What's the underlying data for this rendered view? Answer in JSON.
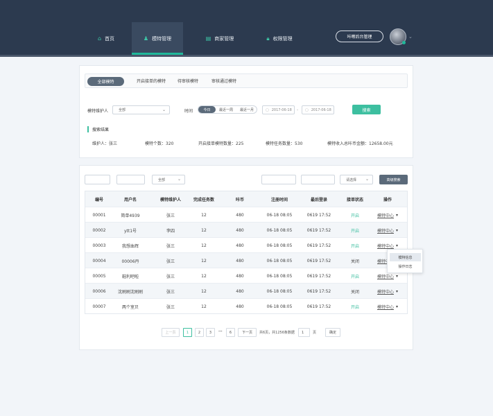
{
  "nav": {
    "items": [
      {
        "label": "首页",
        "icon": "home-icon"
      },
      {
        "label": "模特管理",
        "icon": "user-group-icon"
      },
      {
        "label": "商家管理",
        "icon": "shop-icon"
      },
      {
        "label": "权限管理",
        "icon": "lock-icon"
      }
    ],
    "admin_button": "咔嚓后台管理",
    "accent": "#1fb89a"
  },
  "tabs": [
    "全部模特",
    "开启接单的模特",
    "待审核模特",
    "审核通过模特"
  ],
  "filter": {
    "guardian_label": "模特维护人",
    "guardian_value": "全部",
    "time_label": "时间",
    "time_segments": [
      "今日",
      "最近一周",
      "最近一月"
    ],
    "date_from": "2017-06-18",
    "date_to": "2017-06-18",
    "date_sep": "-",
    "search_button": "搜索"
  },
  "results": {
    "title": "搜索结果",
    "stats": [
      "维护人：张三",
      "模特个数：320",
      "开启接单模特数量：225",
      "模特任务数量：530",
      "模特收入总咔币金额：12658.00元"
    ]
  },
  "toolbar": {
    "select1": "全部",
    "select2": "请选择",
    "advanced_search": "高级搜索"
  },
  "table": {
    "headers": [
      "编号",
      "用户名",
      "模特维护人",
      "完成任务数",
      "咔币",
      "注册时间",
      "最后登录",
      "接单状态",
      "操作"
    ],
    "rows": [
      [
        "00001",
        "简单4939",
        "张三",
        "12",
        "480",
        "06-18  08:05",
        "0619 17:52",
        "开启",
        "模特中心"
      ],
      [
        "00002",
        "ytt1号",
        "李四",
        "12",
        "480",
        "06-18  08:05",
        "0619 17:52",
        "开启",
        "模特中心"
      ],
      [
        "00003",
        "我想血辉",
        "张三",
        "12",
        "480",
        "06-18  08:05",
        "0619 17:52",
        "开启",
        "模特中心"
      ],
      [
        "00004",
        "00006丹",
        "张三",
        "12",
        "480",
        "06-18  08:05",
        "0619 17:52",
        "关闭",
        "模特中心"
      ],
      [
        "00005",
        "鞋利吧啦",
        "张三",
        "12",
        "480",
        "06-18  08:05",
        "0619 17:52",
        "开启",
        "模特中心"
      ],
      [
        "00006",
        "沈刷刷沈刷刷",
        "张三",
        "12",
        "480",
        "06-18  08:05",
        "0619 17:52",
        "关闭",
        "模特中心"
      ],
      [
        "00007",
        "两个室贝",
        "张三",
        "12",
        "480",
        "06-18  08:05",
        "0619 17:52",
        "开启",
        "模特中心"
      ]
    ]
  },
  "dropdown": [
    "模特信息",
    "操作日志"
  ],
  "pagination": {
    "prev": "上一页",
    "pages": [
      "1",
      "2",
      "3",
      "6"
    ],
    "ellipsis": "...",
    "next": "下一页",
    "summary": "共6页，共1256条数据",
    "goto_value": "1",
    "page_unit": "页",
    "confirm": "确定"
  }
}
